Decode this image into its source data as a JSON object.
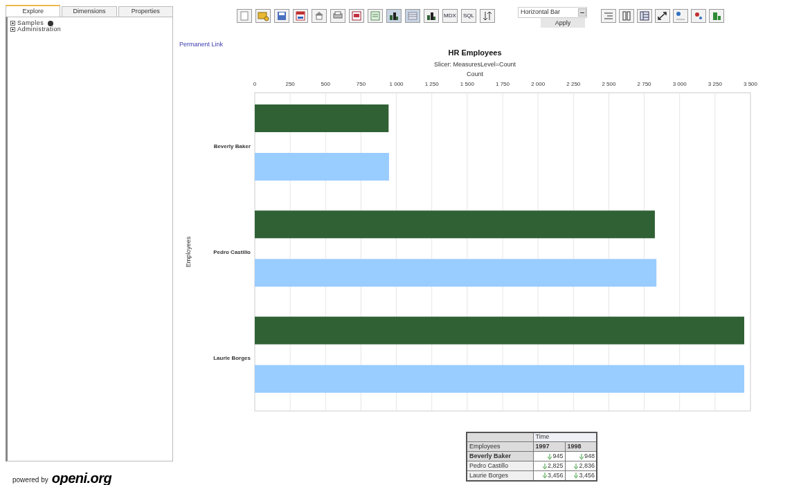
{
  "sidebar": {
    "tabs": [
      {
        "label": "Explore",
        "selected": true
      },
      {
        "label": "Dimensions",
        "selected": false
      },
      {
        "label": "Properties",
        "selected": false
      }
    ],
    "tree": [
      {
        "label": "Samples",
        "busy": true
      },
      {
        "label": "Administration",
        "busy": false
      }
    ],
    "footer": {
      "prefix": "powered by",
      "logo": "openi.org"
    }
  },
  "toolbar": {
    "buttons": [
      {
        "kind": "doc"
      },
      {
        "kind": "folder"
      },
      {
        "kind": "save"
      },
      {
        "kind": "calendar"
      },
      {
        "kind": "home"
      },
      {
        "kind": "print"
      },
      {
        "kind": "pdf"
      },
      {
        "kind": "excel"
      },
      {
        "kind": "chart",
        "selected": true
      },
      {
        "kind": "table",
        "selected": true
      },
      {
        "kind": "chart",
        "selected": false
      },
      {
        "kind": "text",
        "label": "MDX"
      },
      {
        "kind": "text",
        "label": "SQL"
      },
      {
        "kind": "sort"
      }
    ],
    "chart_type": {
      "value": "Horizontal Bar"
    },
    "apply": "Apply",
    "right_buttons": [
      {
        "kind": "indent"
      },
      {
        "kind": "columns"
      },
      {
        "kind": "rows"
      },
      {
        "kind": "swap"
      },
      {
        "kind": "dot"
      },
      {
        "kind": "reddot"
      },
      {
        "kind": "greenbar"
      }
    ]
  },
  "permanent_link": "Permanent Link",
  "chart": {
    "chart_data": {
      "type": "bar",
      "orientation": "horizontal",
      "title": "HR Employees",
      "subtitle": "Slicer: MeasuresLevel=Count",
      "xlabel": "Count",
      "ylabel": "Employees",
      "categories": [
        "Beverly Baker",
        "Pedro Castillo",
        "Laurie Borges"
      ],
      "series": [
        {
          "color": "#2f6135",
          "values": [
            945,
            2825,
            3456
          ]
        },
        {
          "color": "#99ccff",
          "values": [
            948,
            2836,
            3456
          ]
        }
      ],
      "grid": true,
      "xlim": [
        0,
        3500
      ],
      "xticks": [
        0,
        250,
        500,
        750,
        {
          "value": 1000,
          "label": "1 000"
        },
        {
          "value": 1250,
          "label": "1 250"
        },
        {
          "value": 1500,
          "label": "1 500"
        },
        {
          "value": 1750,
          "label": "1 750"
        },
        {
          "value": 2000,
          "label": "2 000"
        },
        {
          "value": 2250,
          "label": "2 250"
        },
        {
          "value": 2500,
          "label": "2 500"
        },
        {
          "value": 2750,
          "label": "2 750"
        },
        {
          "value": 3000,
          "label": "3 000"
        },
        {
          "value": 3250,
          "label": "3 250"
        },
        {
          "value": 3500,
          "label": "3 500"
        }
      ]
    }
  },
  "table": {
    "group_header": "Time",
    "columns": [
      "Employees",
      "1997",
      "1998"
    ],
    "rows": [
      {
        "cells": [
          "Beverly Baker",
          "945",
          "948"
        ],
        "highlighted": true
      },
      {
        "cells": [
          "Pedro Castillo",
          "2,825",
          "2,836"
        ],
        "highlighted": false
      },
      {
        "cells": [
          "Laurie Borges",
          "3,456",
          "3,456"
        ],
        "highlighted": false
      }
    ]
  }
}
